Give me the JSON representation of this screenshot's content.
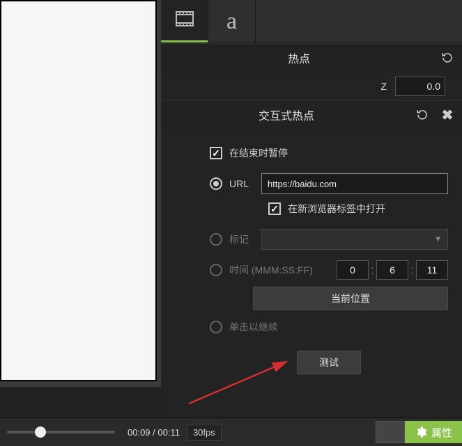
{
  "tabs": {
    "media": "film",
    "text": "a"
  },
  "hotspot": {
    "title": "热点",
    "z_label": "Z",
    "z_value": "0.0"
  },
  "interactive": {
    "title": "交互式热点",
    "pause_label": "在结束时暂停",
    "url_label": "URL",
    "url_value": "https://baidu.com",
    "newtab_label": "在新浏览器标签中打开",
    "marker_label": "标记",
    "time_label": "时间 (MMM:SS:FF)",
    "time_m": "0",
    "time_s": "6",
    "time_f": "11",
    "current_pos": "当前位置",
    "click_continue": "单击以继续",
    "test": "测试"
  },
  "footer": {
    "time": "00:09 / 00:11",
    "fps": "30fps",
    "properties": "属性"
  }
}
